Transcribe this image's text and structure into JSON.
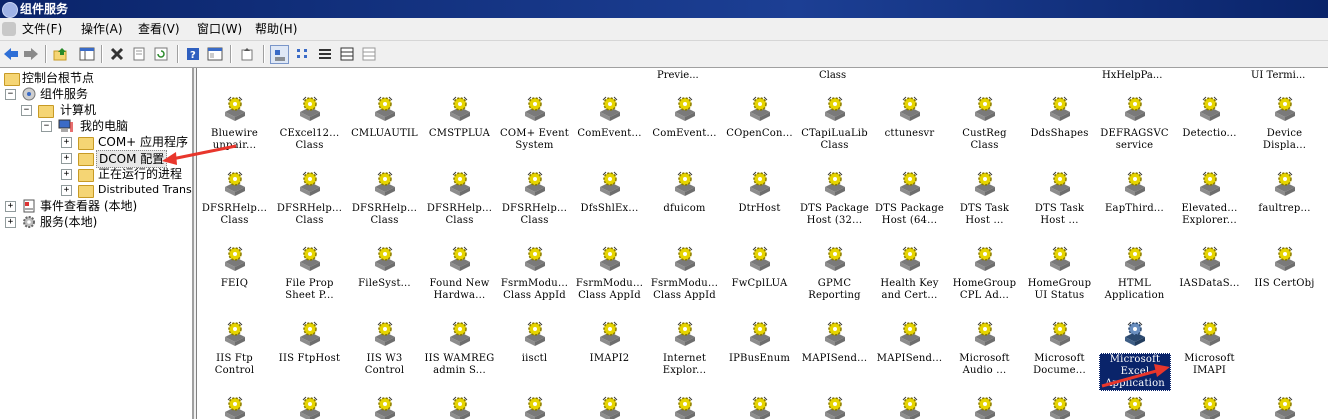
{
  "window": {
    "title": "组件服务"
  },
  "menu": {
    "items": [
      {
        "label": "文件(F)",
        "name": "menu-file"
      },
      {
        "label": "操作(A)",
        "name": "menu-action"
      },
      {
        "label": "查看(V)",
        "name": "menu-view"
      },
      {
        "label": "窗口(W)",
        "name": "menu-window"
      },
      {
        "label": "帮助(H)",
        "name": "menu-help"
      }
    ]
  },
  "toolbar": {
    "buttons": [
      "back-icon",
      "forward-icon",
      "up-icon",
      "show-tree-icon",
      "delete-icon",
      "properties-icon",
      "refresh-icon",
      "help-icon",
      "console-icon",
      "export-icon",
      "large-icons-view",
      "small-icons-view",
      "list-view",
      "detail-view",
      "extra-view"
    ]
  },
  "tree": {
    "nodes": [
      {
        "label": "控制台根节点",
        "name": "tree-console-root",
        "icon": "folder"
      },
      {
        "label": "组件服务",
        "name": "tree-component-services",
        "icon": "component"
      },
      {
        "label": "计算机",
        "name": "tree-computers",
        "icon": "folder"
      },
      {
        "label": "我的电脑",
        "name": "tree-my-computer",
        "icon": "computer"
      },
      {
        "label": "COM+ 应用程序",
        "name": "tree-com-apps",
        "icon": "folder"
      },
      {
        "label": "DCOM 配置",
        "name": "tree-dcom-config",
        "icon": "folder"
      },
      {
        "label": "正在运行的进程",
        "name": "tree-running-processes",
        "icon": "folder"
      },
      {
        "label": "Distributed Transaction Coordinator",
        "name": "tree-dtc",
        "icon": "folder"
      },
      {
        "label": "事件查看器 (本地)",
        "name": "tree-event-viewer",
        "icon": "event"
      },
      {
        "label": "服务(本地)",
        "name": "tree-services",
        "icon": "gear"
      }
    ]
  },
  "top_row": [
    "Previe...",
    "Class",
    "HxHelpPa...",
    "UI Termi..."
  ],
  "items": [
    "Bluewire\nunpair...",
    "CExcel12...\nClass",
    "CMLUAUTIL",
    "CMSTPLUA",
    "COM+ Event\nSystem",
    "ComEvent...",
    "ComEvent...",
    "COpenCon...",
    "CTapiLuaLib\nClass",
    "cttunesvr",
    "CustReg\nClass",
    "DdsShapes",
    "DEFRAGSVC\nservice",
    "Detectio...",
    "Device\nDispla...",
    "DFSRHelp...\nClass",
    "DFSRHelp...\nClass",
    "DFSRHelp...\nClass",
    "DFSRHelp...\nClass",
    "DFSRHelp...\nClass",
    "DfsShlEx...",
    "dfuicom",
    "DtrHost",
    "DTS Package\nHost (32...",
    "DTS Package\nHost (64...",
    "DTS Task\nHost ...",
    "DTS Task\nHost ...",
    "EapThird...",
    "Elevated...\nExplorer...",
    "faultrep...",
    "FEIQ",
    "File Prop\nSheet P...",
    "FileSyst...",
    "Found New\nHardwa...",
    "FsrmModu...\nClass AppId",
    "FsrmModu...\nClass AppId",
    "FsrmModu...\nClass AppId",
    "FwCplLUA",
    "GPMC\nReporting",
    "Health Key\nand Cert...",
    "HomeGroup\nCPL Ad...",
    "HomeGroup\nUI Status",
    "HTML\nApplication",
    "IASDataS...",
    "IIS CertObj",
    "IIS Ftp\nControl",
    "IIS FtpHost",
    "IIS W3\nControl",
    "IIS WAMREG\nadmin S...",
    "iisctl",
    "IMAPI2",
    "Internet\nExplor...",
    "IPBusEnum",
    "MAPISend...",
    "MAPISend...",
    "Microsoft\nAudio ...",
    "Microsoft\nDocume...",
    "Microsoft\nExcel\nApplication",
    "Microsoft\nIMAPI"
  ],
  "selected_item": "Microsoft\nExcel\nApplication",
  "colors": {
    "titlebar": "#0a246a",
    "selection": "#0a246a",
    "arrow": "#e8362c"
  }
}
